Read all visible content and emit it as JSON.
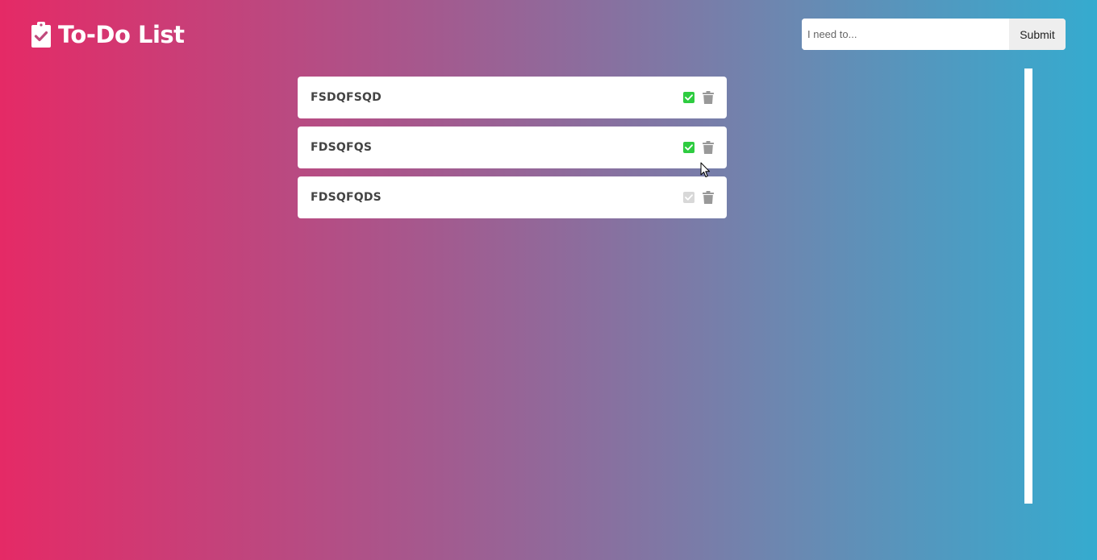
{
  "app": {
    "title": "To-Do List",
    "icon": "clipboard-check-icon"
  },
  "form": {
    "placeholder": "I need to...",
    "value": "",
    "submit_label": "Submit"
  },
  "todos": [
    {
      "text": "FSDQFSQD",
      "completed": true
    },
    {
      "text": "FDSQFQS",
      "completed": true
    },
    {
      "text": "FDSQFQDS",
      "completed": false
    }
  ],
  "colors": {
    "completed": "#2ecc40",
    "pending": "#d8d8d8",
    "trash": "#999999",
    "gradient_start": "#e52a66",
    "gradient_end": "#35abcf"
  }
}
